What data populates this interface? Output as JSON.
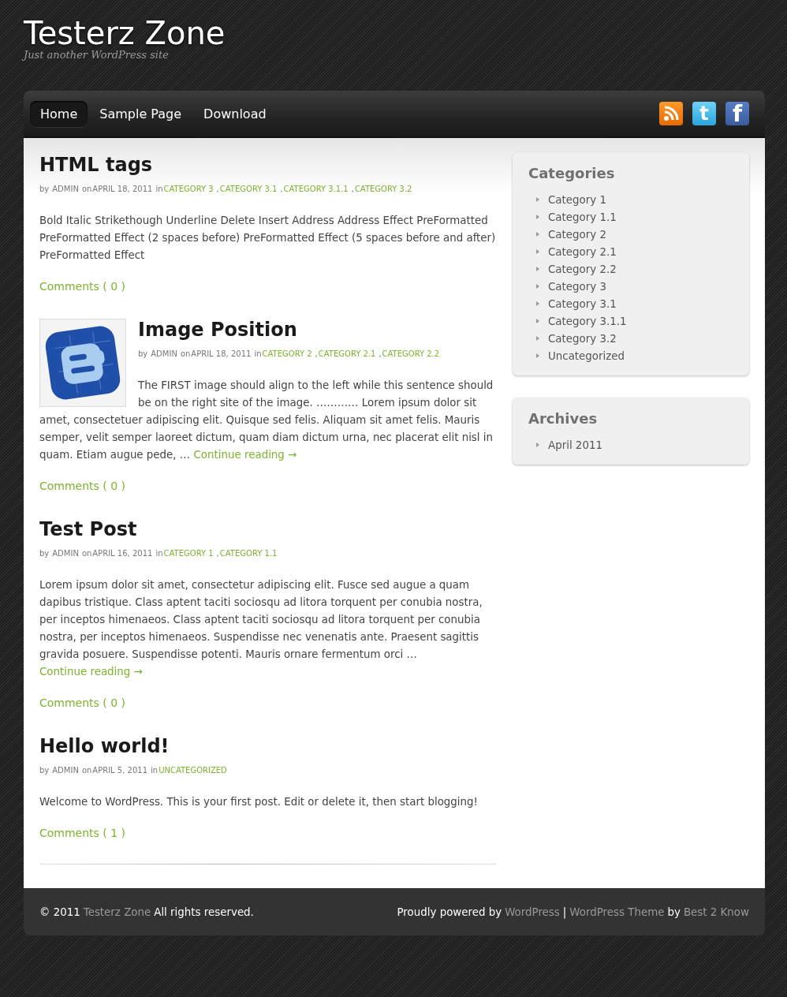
{
  "site": {
    "title": "Testerz Zone",
    "tagline": "Just another WordPress site"
  },
  "nav": [
    {
      "label": "Home",
      "selected": true
    },
    {
      "label": "Sample Page",
      "selected": false
    },
    {
      "label": "Download",
      "selected": false
    }
  ],
  "social": [
    {
      "kind": "feed"
    },
    {
      "kind": "letter",
      "label": "t"
    },
    {
      "kind": "letter",
      "label": "f"
    }
  ],
  "posts": [
    {
      "title": "HTML tags",
      "meta": [
        {
          "text": "by",
          "kind": "plain"
        },
        {
          "text": "ADMIN",
          "kind": "muted"
        },
        {
          "text": "on",
          "kind": "plain"
        },
        {
          "text": "APRIL 18, 2011",
          "kind": "muted"
        },
        {
          "text": "in",
          "kind": "plain"
        },
        {
          "text": "CATEGORY 3",
          "kind": "link"
        },
        {
          "text": ",",
          "kind": "plain"
        },
        {
          "text": "CATEGORY 3.1",
          "kind": "link"
        },
        {
          "text": ",",
          "kind": "plain"
        },
        {
          "text": "CATEGORY 3.1.1",
          "kind": "link"
        },
        {
          "text": ",",
          "kind": "plain"
        },
        {
          "text": "CATEGORY 3.2",
          "kind": "link"
        }
      ],
      "body": "Bold Italic Strikethough Underline Delete Insert Address Address Effect PreFormatted PreFormatted Effect (2 spaces before) PreFormatted Effect (5 spaces before and after) PreFormatted Effect",
      "comments": "Comments ( 0 )"
    },
    {
      "title": "Image Position",
      "meta": [
        {
          "text": "by",
          "kind": "plain"
        },
        {
          "text": "ADMIN",
          "kind": "muted"
        },
        {
          "text": "on",
          "kind": "plain"
        },
        {
          "text": "APRIL 18, 2011",
          "kind": "muted"
        },
        {
          "text": "in",
          "kind": "plain"
        },
        {
          "text": "CATEGORY 2",
          "kind": "link"
        },
        {
          "text": ",",
          "kind": "plain"
        },
        {
          "text": "CATEGORY 2.1",
          "kind": "link"
        },
        {
          "text": ",",
          "kind": "plain"
        },
        {
          "text": "CATEGORY 2.2",
          "kind": "link"
        }
      ],
      "body": "The FIRST image should align to the left while this sentence should be on the right site of the image. ………… Lorem ipsum dolor sit amet, consectetuer adipiscing elit. Quisque sed felis. Aliquam sit amet felis. Mauris semper, velit semper laoreet dictum, quam diam dictum urna, nec placerat elit nisl in quam. Etiam augue pede, …",
      "more": "Continue reading →",
      "comments": "Comments ( 0 )"
    },
    {
      "title": "Test Post",
      "meta": [
        {
          "text": "by",
          "kind": "plain"
        },
        {
          "text": "ADMIN",
          "kind": "muted"
        },
        {
          "text": "on",
          "kind": "plain"
        },
        {
          "text": "APRIL 16, 2011",
          "kind": "muted"
        },
        {
          "text": "in",
          "kind": "plain"
        },
        {
          "text": "CATEGORY 1",
          "kind": "link"
        },
        {
          "text": ",",
          "kind": "plain"
        },
        {
          "text": "CATEGORY 1.1",
          "kind": "link"
        }
      ],
      "body": "Lorem ipsum dolor sit amet, consectetur adipiscing elit. Fusce sed augue a quam dapibus tristique. Class aptent taciti sociosqu ad litora torquent per conubia nostra, per inceptos himenaeos. Class aptent taciti sociosqu ad litora torquent per conubia nostra, per inceptos himenaeos. Suspendisse nec venenatis ante. Praesent sagittis gravida posuere. Suspendisse potenti. Mauris ornare fermentum orci …",
      "more": "Continue reading →",
      "comments": "Comments ( 0 )"
    },
    {
      "title": "Hello world!",
      "meta": [
        {
          "text": "by",
          "kind": "plain"
        },
        {
          "text": "ADMIN",
          "kind": "muted"
        },
        {
          "text": "on",
          "kind": "plain"
        },
        {
          "text": "APRIL 5, 2011",
          "kind": "muted"
        },
        {
          "text": "in",
          "kind": "plain"
        },
        {
          "text": "UNCATEGORIZED",
          "kind": "link"
        }
      ],
      "body": "Welcome to WordPress. This is your first post. Edit or delete it, then start blogging!",
      "comments": "Comments ( 1 )"
    }
  ],
  "sidebar": [
    {
      "title": "Categories",
      "items": [
        "Category 1",
        "Category 1.1",
        "Category 2",
        "Category 2.1",
        "Category 2.2",
        "Category 3",
        "Category 3.1",
        "Category 3.1.1",
        "Category 3.2",
        "Uncategorized"
      ]
    },
    {
      "title": "Archives",
      "items": [
        "April 2011"
      ]
    }
  ],
  "footer": {
    "left": [
      {
        "text": "© 2011",
        "kind": "plain"
      },
      {
        "text": "Testerz Zone",
        "kind": "link"
      },
      {
        "text": "All rights reserved.",
        "kind": "plain"
      }
    ],
    "right": [
      {
        "text": "Proudly powered by",
        "kind": "plain"
      },
      {
        "text": "WordPress",
        "kind": "link"
      },
      {
        "text": "|",
        "kind": "plain"
      },
      {
        "text": "WordPress Theme",
        "kind": "link"
      },
      {
        "text": "by",
        "kind": "plain"
      },
      {
        "text": "Best 2 Know",
        "kind": "link"
      }
    ]
  }
}
